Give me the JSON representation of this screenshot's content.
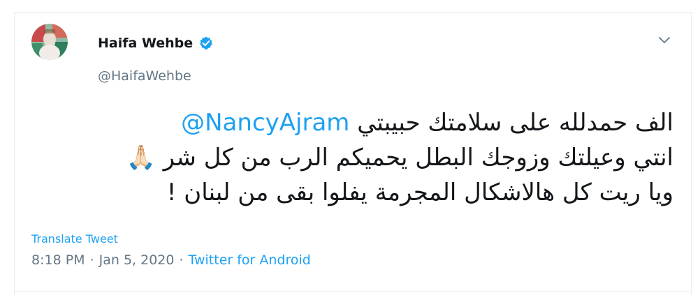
{
  "user": {
    "name": "Haifa Wehbe",
    "handle": "@HaifaWehbe",
    "verified": true
  },
  "tweet": {
    "lines": [
      {
        "text": "الف حمدلله على سلامتك حبيبتي ",
        "mention": "@NancyAjram"
      },
      {
        "text": "انتي وعيلتك وزوجك البطل يحميكم الرب من كل شر ",
        "emoji": "🙏🏻"
      },
      {
        "text": "ويا ريت كل هالاشكال المجرمة يفلوا بقى من لبنان !"
      }
    ]
  },
  "actions": {
    "translate_label": "Translate Tweet"
  },
  "meta": {
    "time": "8:18 PM",
    "separator": "·",
    "date": "Jan 5, 2020",
    "source": "Twitter for Android"
  },
  "icons": {
    "verified": "verified-badge-icon",
    "caret": "chevron-down-icon",
    "emoji": "folded-hands-emoji"
  },
  "colors": {
    "link": "#1da1f2",
    "secondary": "#657786",
    "text": "#14171a",
    "border": "#e6ecf0"
  }
}
